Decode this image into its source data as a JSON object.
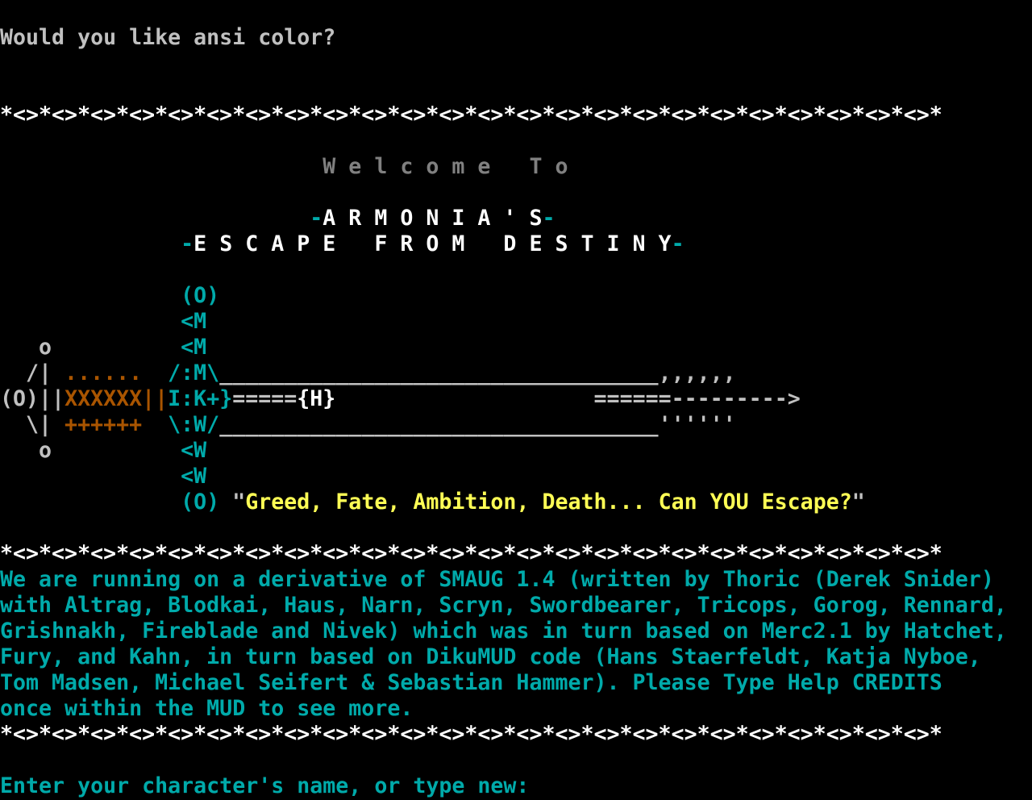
{
  "palette": {
    "background": "#000000",
    "gray": "#c0c0c0",
    "dark_gray": "#808080",
    "white": "#ffffff",
    "cyan": "#00aaaa",
    "orange": "#aa5500",
    "yellow": "#ffff55"
  },
  "terminal": {
    "lines": [
      [
        {
          "text": "Would you like ansi color?",
          "color": "gray"
        }
      ],
      [],
      [],
      [
        {
          "text": "*<>*<>*<>*<>*<>*<>*<>*<>*<>*<>*<>*<>*<>*<>*<>*<>*<>*<>*<>*<>*<>*<>*<>*<>*",
          "color": "white"
        }
      ],
      [],
      [
        {
          "text": "                         W e l c o m e   T o",
          "color": "dgray"
        }
      ],
      [],
      [
        {
          "text": "                        -",
          "color": "cyan"
        },
        {
          "text": "A R M O N I A ' S",
          "color": "white"
        },
        {
          "text": "-",
          "color": "cyan"
        }
      ],
      [
        {
          "text": "              -",
          "color": "cyan"
        },
        {
          "text": "E S C A P E   F R O M   D E S T I N Y",
          "color": "white"
        },
        {
          "text": "-",
          "color": "cyan"
        }
      ],
      [],
      [
        {
          "text": "              (O)",
          "color": "cyan"
        }
      ],
      [
        {
          "text": "              <M",
          "color": "cyan"
        }
      ],
      [
        {
          "text": "   o",
          "color": "gray"
        },
        {
          "text": "          <M",
          "color": "cyan"
        }
      ],
      [
        {
          "text": "  /|",
          "color": "gray"
        },
        {
          "text": " ......",
          "color": "orange"
        },
        {
          "text": "  /:M\\",
          "color": "cyan"
        },
        {
          "text": "__________________________________,,,,,,",
          "color": "gray"
        }
      ],
      [
        {
          "text": "(O)||",
          "color": "gray"
        },
        {
          "text": "XXXXXX||",
          "color": "orange"
        },
        {
          "text": "I:K+}",
          "color": "cyan"
        },
        {
          "text": "=====",
          "color": "gray"
        },
        {
          "text": "{H}",
          "color": "white"
        },
        {
          "text": "                    ======--------->",
          "color": "gray"
        }
      ],
      [
        {
          "text": "  \\|",
          "color": "gray"
        },
        {
          "text": " ++++++",
          "color": "orange"
        },
        {
          "text": "  \\:W/",
          "color": "cyan"
        },
        {
          "text": "__________________________________''''''",
          "color": "gray"
        }
      ],
      [
        {
          "text": "   o",
          "color": "gray"
        },
        {
          "text": "          <W",
          "color": "cyan"
        }
      ],
      [
        {
          "text": "              <W",
          "color": "cyan"
        }
      ],
      [
        {
          "text": "              (O) ",
          "color": "cyan"
        },
        {
          "text": "\"",
          "color": "gray"
        },
        {
          "text": "Greed, Fate, Ambition, Death... Can YOU Escape?",
          "color": "yellow"
        },
        {
          "text": "\"",
          "color": "gray"
        }
      ],
      [],
      [
        {
          "text": "*<>*<>*<>*<>*<>*<>*<>*<>*<>*<>*<>*<>*<>*<>*<>*<>*<>*<>*<>*<>*<>*<>*<>*<>*",
          "color": "white"
        }
      ],
      [
        {
          "text": "We are running on a derivative of SMAUG 1.4 (written by Thoric (Derek Snider)",
          "color": "cyan"
        }
      ],
      [
        {
          "text": "with Altrag, Blodkai, Haus, Narn, Scryn, Swordbearer, Tricops, Gorog, Rennard,",
          "color": "cyan"
        }
      ],
      [
        {
          "text": "Grishnakh, Fireblade and Nivek) which was in turn based on Merc2.1 by Hatchet,",
          "color": "cyan"
        }
      ],
      [
        {
          "text": "Fury, and Kahn, in turn based on DikuMUD code (Hans Staerfeldt, Katja Nyboe,",
          "color": "cyan"
        }
      ],
      [
        {
          "text": "Tom Madsen, Michael Seifert & Sebastian Hammer). Please Type Help CREDITS",
          "color": "cyan"
        }
      ],
      [
        {
          "text": "once within the MUD to see more.",
          "color": "cyan"
        }
      ],
      [
        {
          "text": "*<>*<>*<>*<>*<>*<>*<>*<>*<>*<>*<>*<>*<>*<>*<>*<>*<>*<>*<>*<>*<>*<>*<>*<>*",
          "color": "white"
        }
      ],
      [],
      [
        {
          "text": "Enter your character's name, or type new: ",
          "color": "cyan"
        }
      ]
    ]
  }
}
